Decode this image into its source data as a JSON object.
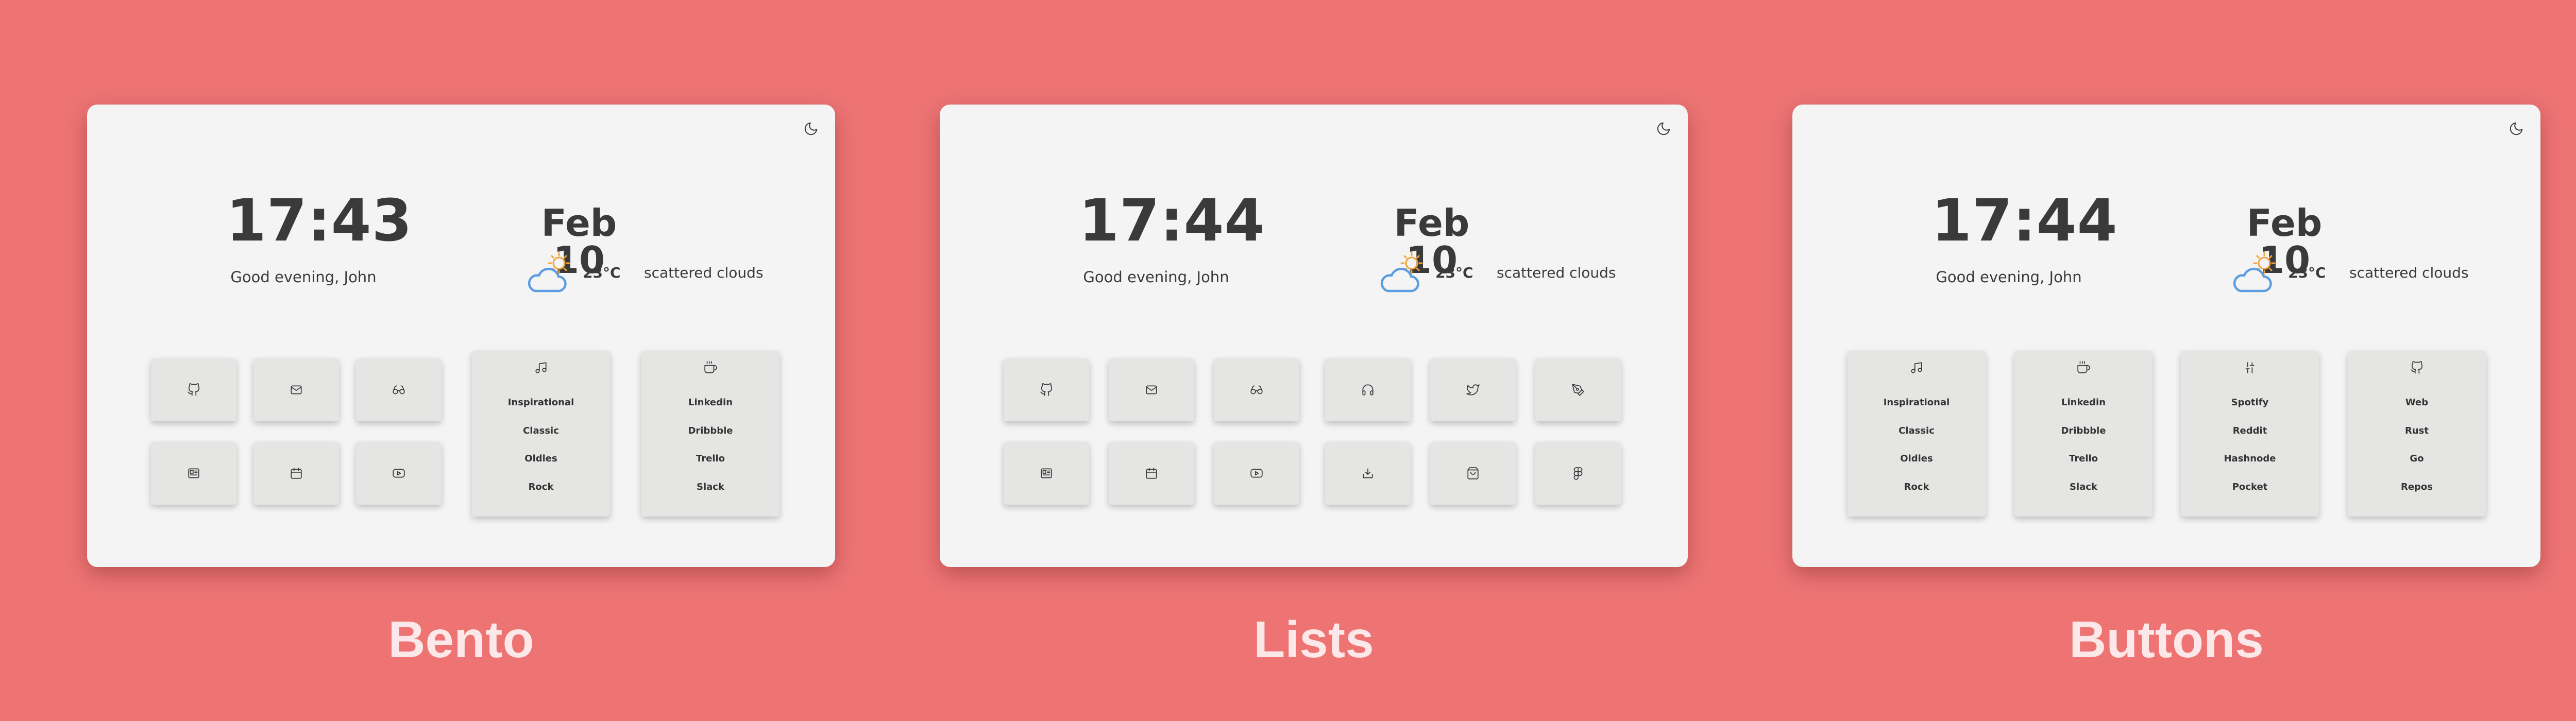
{
  "variants": [
    {
      "label": "Bento",
      "theme_toggle_icon": "moon-icon",
      "clock": {
        "time": "17:43",
        "greeting": "Good evening, John"
      },
      "date": "Feb 10",
      "weather": {
        "icon": "partly-cloudy-icon",
        "temp": "23°C",
        "description": "scattered clouds"
      },
      "buttons": [
        {
          "icon": "github-icon"
        },
        {
          "icon": "mail-icon"
        },
        {
          "icon": "glasses-icon"
        },
        {
          "icon": "newspaper-icon"
        },
        {
          "icon": "calendar-icon"
        },
        {
          "icon": "youtube-icon"
        }
      ],
      "lists": [
        {
          "icon": "music-icon",
          "items": [
            "Inspirational",
            "Classic",
            "Oldies",
            "Rock"
          ]
        },
        {
          "icon": "coffee-icon",
          "items": [
            "Linkedin",
            "Dribbble",
            "Trello",
            "Slack"
          ]
        }
      ]
    },
    {
      "label": "Lists",
      "theme_toggle_icon": "moon-icon",
      "clock": {
        "time": "17:44",
        "greeting": "Good evening, John"
      },
      "date": "Feb 10",
      "weather": {
        "icon": "partly-cloudy-icon",
        "temp": "23°C",
        "description": "scattered clouds"
      },
      "buttons": [
        {
          "icon": "github-icon"
        },
        {
          "icon": "mail-icon"
        },
        {
          "icon": "glasses-icon"
        },
        {
          "icon": "headphones-icon"
        },
        {
          "icon": "twitter-icon"
        },
        {
          "icon": "pen-tool-icon"
        },
        {
          "icon": "newspaper-icon"
        },
        {
          "icon": "calendar-icon"
        },
        {
          "icon": "youtube-icon"
        },
        {
          "icon": "download-tray-icon"
        },
        {
          "icon": "shopping-bag-icon"
        },
        {
          "icon": "figma-icon"
        }
      ]
    },
    {
      "label": "Buttons",
      "theme_toggle_icon": "moon-icon",
      "clock": {
        "time": "17:44",
        "greeting": "Good evening, John"
      },
      "date": "Feb 10",
      "weather": {
        "icon": "partly-cloudy-icon",
        "temp": "23°C",
        "description": "scattered clouds"
      },
      "lists": [
        {
          "icon": "music-icon",
          "items": [
            "Inspirational",
            "Classic",
            "Oldies",
            "Rock"
          ]
        },
        {
          "icon": "coffee-icon",
          "items": [
            "Linkedin",
            "Dribbble",
            "Trello",
            "Slack"
          ]
        },
        {
          "icon": "sliders-icon",
          "items": [
            "Spotify",
            "Reddit",
            "Hashnode",
            "Pocket"
          ]
        },
        {
          "icon": "github-icon",
          "items": [
            "Web",
            "Rust",
            "Go",
            "Repos"
          ]
        }
      ]
    }
  ],
  "colors": {
    "background": "#ee7474",
    "panel": "#f4f4f4",
    "tile": "#e5e5e4",
    "text": "#3a3a3a",
    "label": "#fce8e8",
    "cloud": "#5b9ee0",
    "sun": "#f2a43c"
  }
}
